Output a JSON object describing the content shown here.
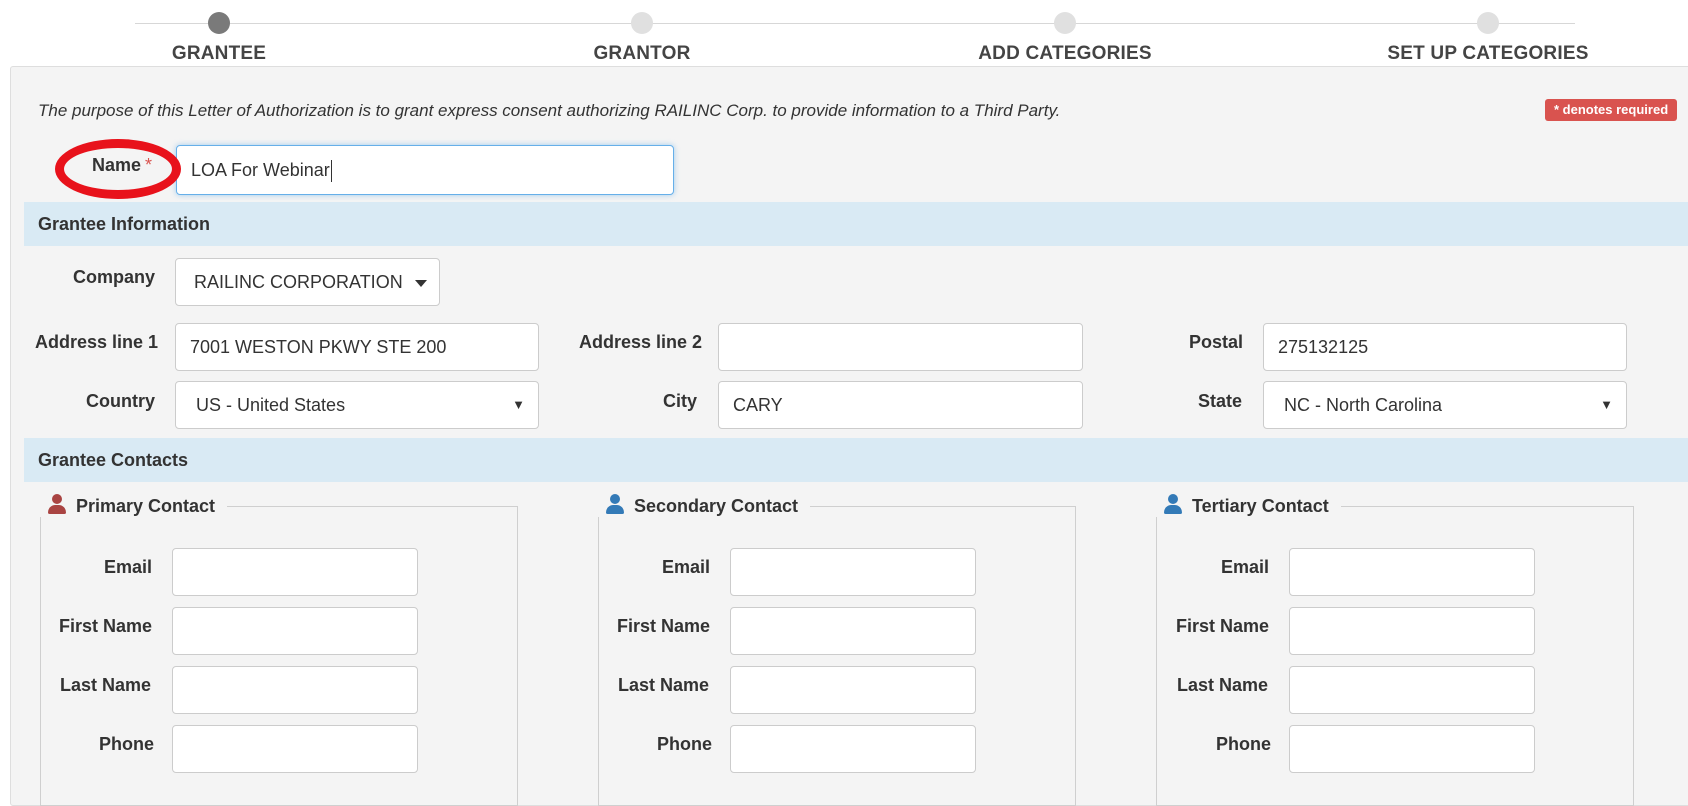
{
  "stepper": {
    "steps": [
      {
        "label": "GRANTEE",
        "active": true
      },
      {
        "label": "GRANTOR",
        "active": false
      },
      {
        "label": "ADD CATEGORIES",
        "active": false
      },
      {
        "label": "SET UP CATEGORIES",
        "active": false
      }
    ]
  },
  "intro_text": "The purpose of this Letter of Authorization is to grant express consent authorizing RAILINC Corp. to provide information to a Third Party.",
  "required_badge": "* denotes required",
  "name_field": {
    "label": "Name",
    "required_mark": "*",
    "value": "LOA For Webinar"
  },
  "grantee_info": {
    "section_title": "Grantee Information",
    "company": {
      "label": "Company",
      "value": "RAILINC CORPORATION"
    },
    "address1": {
      "label": "Address line 1",
      "value": "7001 WESTON PKWY STE 200"
    },
    "address2": {
      "label": "Address line 2",
      "value": ""
    },
    "postal": {
      "label": "Postal",
      "value": "275132125"
    },
    "country": {
      "label": "Country",
      "value": "US - United States"
    },
    "city": {
      "label": "City",
      "value": "CARY"
    },
    "state": {
      "label": "State",
      "value": "NC - North Carolina"
    }
  },
  "grantee_contacts": {
    "section_title": "Grantee Contacts",
    "field_labels": {
      "email": "Email",
      "first_name": "First Name",
      "last_name": "Last Name",
      "phone": "Phone"
    },
    "groups": [
      {
        "title": "Primary Contact",
        "icon": "user-icon",
        "icon_color": "#a94442"
      },
      {
        "title": "Secondary Contact",
        "icon": "user-icon",
        "icon_color": "#337ab7"
      },
      {
        "title": "Tertiary Contact",
        "icon": "user-icon",
        "icon_color": "#337ab7"
      }
    ]
  },
  "colors": {
    "accent_required": "#d9534f",
    "section_bar": "#d9eaf4",
    "focus_border": "#66afe9",
    "annotation_ring": "#e8121b"
  }
}
